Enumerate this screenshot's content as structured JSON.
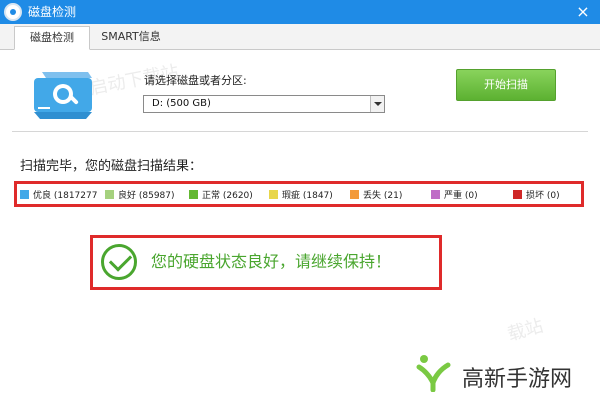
{
  "window": {
    "title": "磁盘检测",
    "close_glyph": "×"
  },
  "tabs": [
    {
      "label": "磁盘检测",
      "active": true
    },
    {
      "label": "SMART信息",
      "active": false
    }
  ],
  "watermarks": {
    "text1": "启动下载站",
    "text2": "载站"
  },
  "drive_selector": {
    "label": "请选择磁盘或者分区:",
    "selected": "D:  (500 GB)"
  },
  "scan_button": {
    "label": "开始扫描"
  },
  "results": {
    "title": "扫描完毕，您的磁盘扫描结果：",
    "legend": [
      {
        "label": "优良 (1817277",
        "color": "#42a8e8"
      },
      {
        "label": "良好 (85987)",
        "color": "#a5d17e"
      },
      {
        "label": "正常 (2620)",
        "color": "#63b832"
      },
      {
        "label": "瑕疵 (1847)",
        "color": "#e8d64a"
      },
      {
        "label": "丢失 (21)",
        "color": "#f39a3a"
      },
      {
        "label": "严重 (0)",
        "color": "#bf6cc6"
      },
      {
        "label": "损坏 (0)",
        "color": "#cf2727"
      }
    ],
    "status": "您的硬盘状态良好，请继续保持！"
  },
  "brand": {
    "name": "高新手游网"
  },
  "colors": {
    "titlebar": "#1f8be6",
    "accent_green": "#4aa62f",
    "highlight_red": "#df2a2a"
  }
}
